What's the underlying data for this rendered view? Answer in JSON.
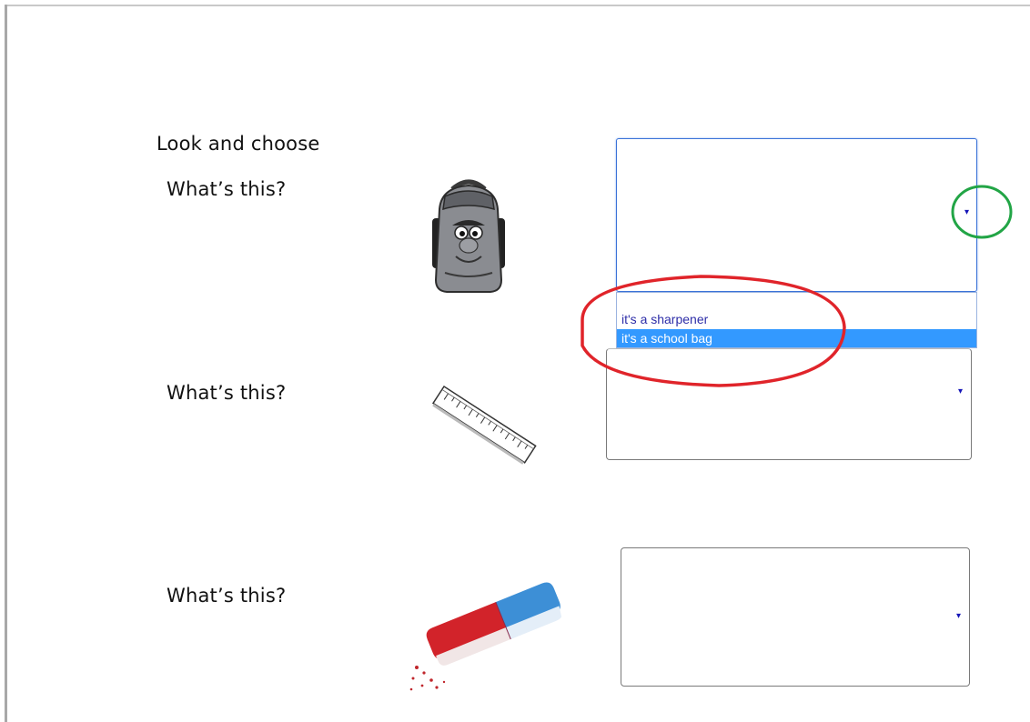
{
  "instruction": "Look and choose",
  "questions": [
    {
      "text": "What’s this?",
      "image_icon": "school-bag-icon",
      "selected_value": ""
    },
    {
      "text": "What’s this?",
      "image_icon": "ruler-icon",
      "selected_value": ""
    },
    {
      "text": "What’s this?",
      "image_icon": "eraser-icon",
      "selected_value": ""
    }
  ],
  "dropdown": {
    "options": [
      "",
      "it's a sharpener",
      "it's a school bag"
    ],
    "highlighted_index": 2,
    "arrow_glyph": "▾"
  },
  "annotations": {
    "circle_arrow_color": "#22a546",
    "circle_options_color": "#e0242a"
  },
  "colors": {
    "highlight": "#3399ff",
    "option_text": "#2d2da8",
    "focus_border": "#3b73d8"
  }
}
